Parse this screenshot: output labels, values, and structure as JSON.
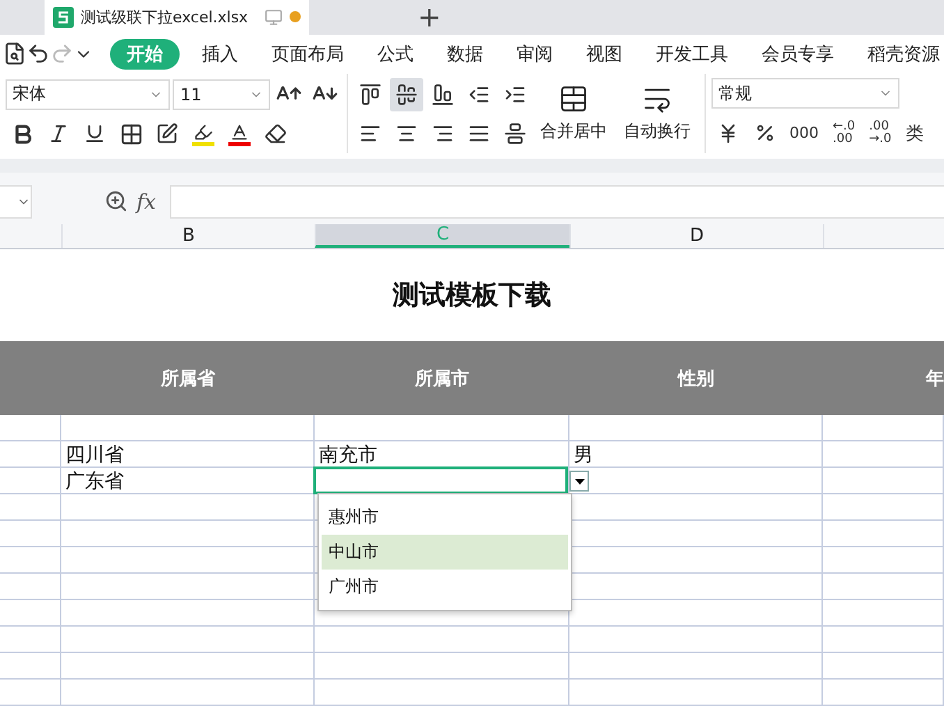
{
  "document_tab": {
    "title": "测试级联下拉excel.xlsx",
    "unsaved": true
  },
  "new_tab": "+",
  "ribbon_tabs": [
    {
      "label": "开始",
      "selected": true
    },
    {
      "label": "插入",
      "selected": false
    },
    {
      "label": "页面布局",
      "selected": false
    },
    {
      "label": "公式",
      "selected": false
    },
    {
      "label": "数据",
      "selected": false
    },
    {
      "label": "审阅",
      "selected": false
    },
    {
      "label": "视图",
      "selected": false
    },
    {
      "label": "开发工具",
      "selected": false
    },
    {
      "label": "会员专享",
      "selected": false
    },
    {
      "label": "稻壳资源",
      "selected": false
    }
  ],
  "font": {
    "name": "宋体",
    "size": "11"
  },
  "vertical_align": [
    {
      "selected": false
    },
    {
      "selected": true
    },
    {
      "selected": false
    }
  ],
  "merge_button": "合并居中",
  "wrap_button": "自动换行",
  "number_format": "常规",
  "thousands": "000",
  "decimal_buttons": [
    {
      "top": "←.0",
      "bottom": ".00"
    },
    {
      "top": ".00",
      "bottom": "→.0"
    }
  ],
  "cut_button": "类",
  "formula": {
    "fx": "fx"
  },
  "columns": [
    {
      "label": "B",
      "selected": false
    },
    {
      "label": "C",
      "selected": true
    },
    {
      "label": "D",
      "selected": false
    }
  ],
  "sheet_title": "测试模板下载",
  "header_cells": [
    "所属省",
    "所属市",
    "性别",
    "年"
  ],
  "rows": [
    {
      "cells": [],
      "active": false
    },
    {
      "cells": [
        "四川省",
        "南充市",
        "男"
      ],
      "active": false
    },
    {
      "cells": [
        "广东省"
      ],
      "active": true
    }
  ],
  "dropdown": {
    "options": [
      {
        "label": "惠州市",
        "selected": false
      },
      {
        "label": "中山市",
        "selected": true
      },
      {
        "label": "广州市",
        "selected": false
      }
    ]
  }
}
